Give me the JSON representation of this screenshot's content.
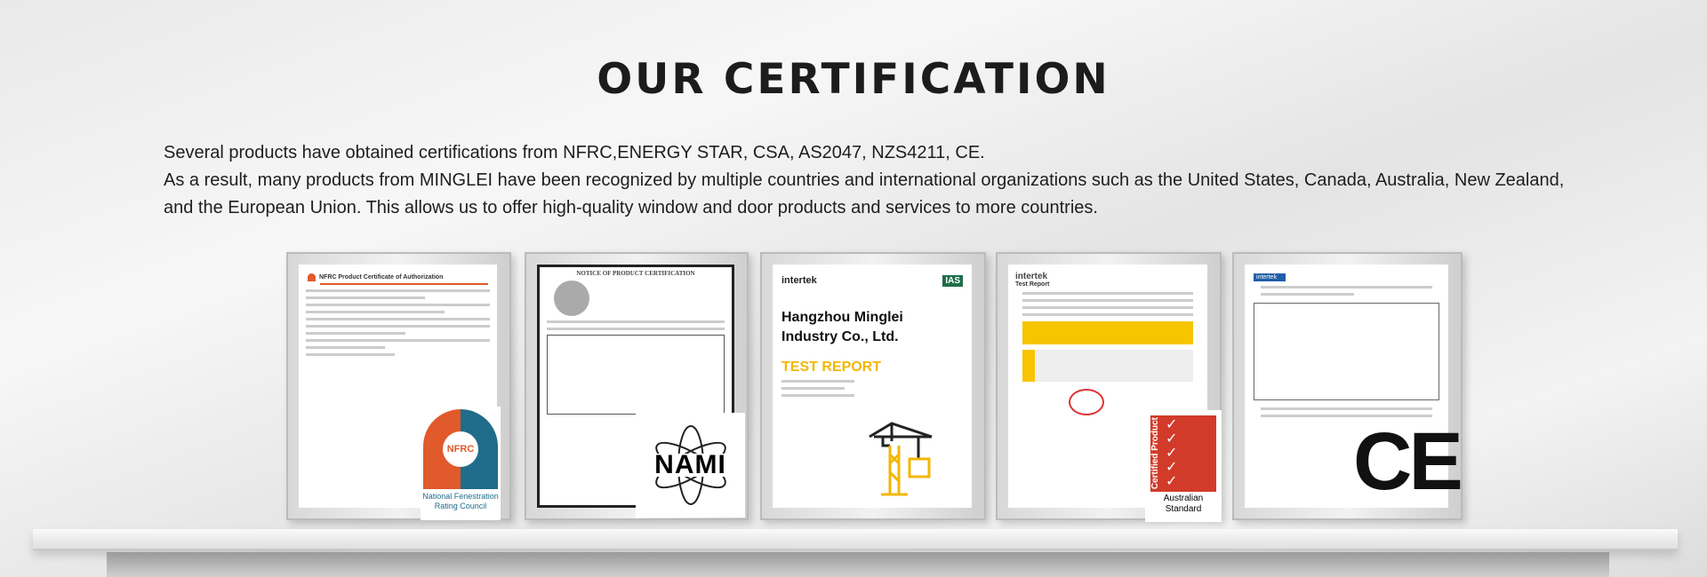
{
  "title": "OUR CERTIFICATION",
  "intro": {
    "line1": "Several products have obtained certifications from NFRC,ENERGY STAR, CSA,  AS2047, NZS4211, CE.",
    "line2": "As a result, many products from MINGLEI have been recognized by multiple countries and international organizations such as the United States, Canada, Australia, New Zealand, and the European Union. This allows us to offer high-quality  window and door products and services to more countries."
  },
  "certificates": [
    {
      "heading": "NFRC Product Certificate of Authorization",
      "badge": "NFRC",
      "badge_caption": "National Fenestration Rating Council"
    },
    {
      "heading": "NOTICE OF PRODUCT CERTIFICATION",
      "badge": "NAMI"
    },
    {
      "brand": "intertek",
      "company": "Hangzhou Minglei Industry Co., Ltd.",
      "report": "TEST REPORT",
      "accred": "IAS"
    },
    {
      "brand": "intertek",
      "heading": "Test Report",
      "badge_top": "Certified Product",
      "badge_caption": "Australian Standard"
    },
    {
      "brand": "intertek",
      "badge": "CE"
    }
  ]
}
